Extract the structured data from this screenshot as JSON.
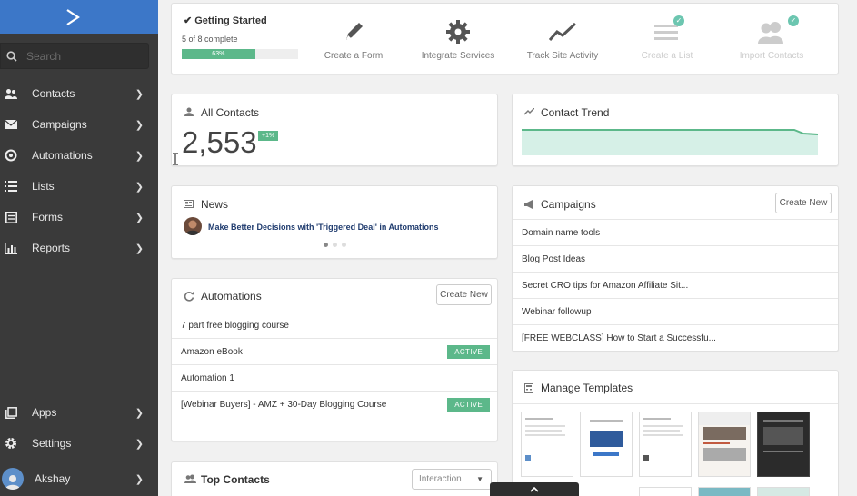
{
  "sidebar": {
    "search_placeholder": "Search",
    "items": [
      {
        "label": "Contacts"
      },
      {
        "label": "Campaigns"
      },
      {
        "label": "Automations"
      },
      {
        "label": "Lists"
      },
      {
        "label": "Forms"
      },
      {
        "label": "Reports"
      }
    ],
    "bottom_items": [
      {
        "label": "Apps"
      },
      {
        "label": "Settings"
      }
    ],
    "user": {
      "name": "Akshay"
    }
  },
  "getting_started": {
    "title": "Getting Started",
    "progress_text": "5 of 8 complete",
    "progress_percent_label": "63%",
    "progress_fraction": 0.63,
    "steps": [
      {
        "label": "Create a Form",
        "icon": "pencil-icon",
        "done": false
      },
      {
        "label": "Integrate Services",
        "icon": "gear-icon",
        "done": false
      },
      {
        "label": "Track Site Activity",
        "icon": "trend-line-icon",
        "done": false
      },
      {
        "label": "Create a List",
        "icon": "list-icon",
        "done": true
      },
      {
        "label": "Import Contacts",
        "icon": "users-icon",
        "done": true
      }
    ]
  },
  "all_contacts": {
    "title": "All Contacts",
    "count": "2,553",
    "change_badge": "+1%"
  },
  "contact_trend": {
    "title": "Contact Trend"
  },
  "news": {
    "title": "News",
    "headline": "Make Better Decisions with 'Triggered Deal' in Automations"
  },
  "campaigns": {
    "title": "Campaigns",
    "create_label": "Create New",
    "items": [
      "Domain name tools",
      "Blog Post Ideas",
      "Secret CRO tips for Amazon Affiliate Sit...",
      "Webinar followup",
      "[FREE WEBCLASS] How to Start a Successfu..."
    ]
  },
  "automations": {
    "title": "Automations",
    "create_label": "Create New",
    "items": [
      {
        "name": "7 part free blogging course",
        "status": ""
      },
      {
        "name": "Amazon eBook",
        "status": "ACTIVE"
      },
      {
        "name": "Automation 1",
        "status": ""
      },
      {
        "name": "[Webinar Buyers] - AMZ + 30-Day Blogging Course",
        "status": "ACTIVE"
      }
    ]
  },
  "manage_templates": {
    "title": "Manage Templates"
  },
  "top_contacts": {
    "title": "Top Contacts",
    "filter_value": "Interaction"
  },
  "colors": {
    "brand_blue": "#3c77c8",
    "sidebar_bg": "#3a3a3a",
    "accent_green": "#5cb88a",
    "active_badge": "#5cb88a"
  }
}
